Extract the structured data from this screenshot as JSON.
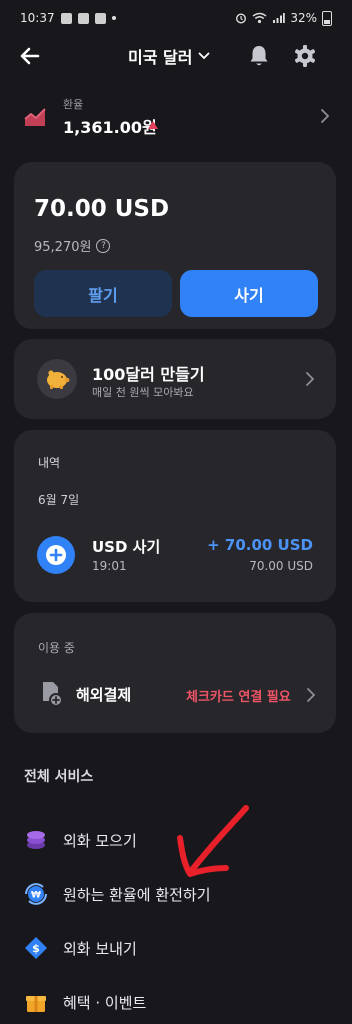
{
  "status_bar": {
    "time": "10:37",
    "battery": "32%"
  },
  "header": {
    "currency_selector": "미국 달러"
  },
  "exchange_rate": {
    "label": "환율",
    "value": "1,361.00원",
    "trend": "up",
    "trend_color": "#e0405a"
  },
  "balance": {
    "amount": "70.00 USD",
    "krw_value": "95,270원",
    "help_symbol": "?",
    "sell_label": "팔기",
    "buy_label": "사기"
  },
  "saving": {
    "title": "100달러 만들기",
    "subtitle": "매일 천 원씩 모아봐요"
  },
  "history": {
    "title": "내역",
    "date": "6월 7일",
    "transactions": [
      {
        "title": "USD 사기",
        "time": "19:01",
        "amount": "+ 70.00 USD",
        "sub_amount": "70.00 USD"
      }
    ]
  },
  "in_use": {
    "title": "이용 중",
    "item_label": "해외결제",
    "item_status": "체크카드 연결 필요"
  },
  "services": {
    "title": "전체 서비스",
    "items": [
      {
        "label": "외화 모으기",
        "icon": "coin-stack-icon"
      },
      {
        "label": "원하는 환율에 환전하기",
        "icon": "exchange-target-icon"
      },
      {
        "label": "외화 보내기",
        "icon": "send-money-icon"
      },
      {
        "label": "혜택 · 이벤트",
        "icon": "gift-icon"
      }
    ]
  },
  "colors": {
    "background": "#18181c",
    "card": "#26262b",
    "accent_blue": "#3182f6",
    "warning_red": "#ef5566",
    "annotation_arrow": "#e8202a"
  }
}
